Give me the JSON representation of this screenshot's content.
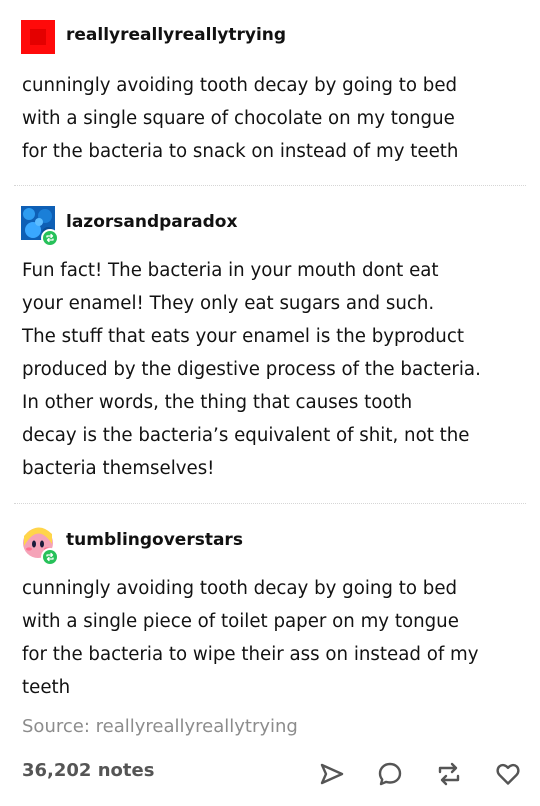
{
  "posts": [
    {
      "username": "reallyreallyreallytrying",
      "avatar": {
        "icon": "red-square-avatar",
        "color": "#ff0a0a"
      },
      "lines": [
        "cunningly avoiding tooth decay by going to bed",
        "with a single square of chocolate on my tongue",
        "for the bacteria to snack on instead of my teeth"
      ]
    },
    {
      "username": "lazorsandparadox",
      "avatar": {
        "icon": "blue-pattern-avatar",
        "color": "#1a7fd8"
      },
      "reblog_icon": "reblog-badge-icon",
      "lines": [
        "Fun fact! The bacteria in your mouth dont eat",
        "your enamel! They only eat sugars and such.",
        "The stuff that eats your enamel is the byproduct",
        "produced by the digestive process of the bacteria.",
        "In other words, the thing that causes tooth",
        "decay is the bacteria’s equivalent of shit, not the",
        "bacteria themselves!"
      ]
    },
    {
      "username": "tumblingoverstars",
      "avatar": {
        "icon": "kirby-avatar",
        "color": "#f5a3b8"
      },
      "reblog_icon": "reblog-badge-icon",
      "lines": [
        "cunningly avoiding tooth decay by going to bed",
        "with a single piece of toilet paper on my tongue",
        "for the bacteria to wipe their ass on instead of my",
        "teeth"
      ]
    }
  ],
  "footer": {
    "source": "Source: reallyreallyreallytrying",
    "notes": "36,202 notes",
    "actions": [
      "send-icon",
      "comment-icon",
      "reblog-icon",
      "heart-icon"
    ]
  },
  "colors": {
    "text": "#121212",
    "muted": "#8c8c8c",
    "reblog_green": "#27c15a"
  }
}
